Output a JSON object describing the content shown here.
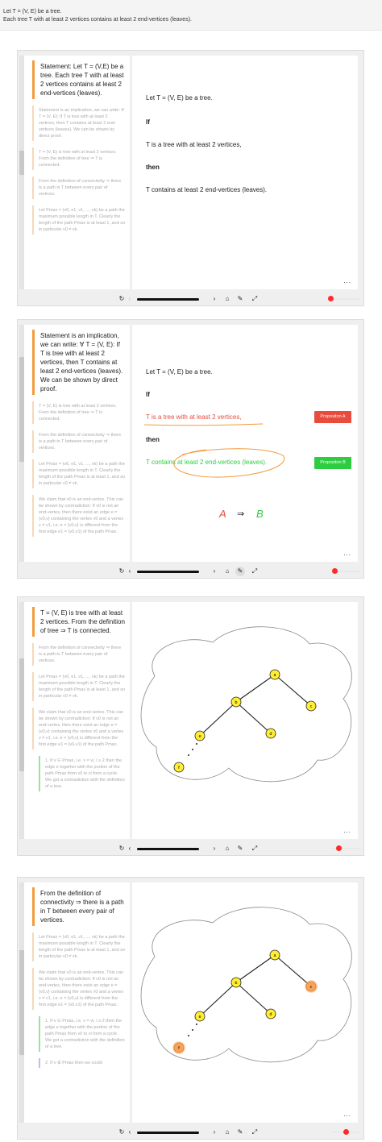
{
  "header": {
    "line1": "Let T = (V, E) be a tree.",
    "line2": "Each tree T with at least 2 vertices contains at least 2 end-vertices (leaves)."
  },
  "steps": {
    "statement": "Statement: Let T = (V,E) be a tree. Each tree T with at least 2 vertices contains at least 2 end-vertices (leaves).",
    "implication": "Statement is an implication, we can write: ∀ T = (V, E): If T is tree with at least 2 vertices, then T contains at least 2 end-vertices (leaves). We can be shown by direct proof.",
    "connected": "T = (V, E) is tree with at least 2 vertices. From the definition of tree ⇒ T is connected.",
    "path": "From the definition of connectivity ⇒ there is a path in T between every pair of vertices.",
    "maxpath": "Let Pmax = (v0, e1, v1, ..., vk) be a path the maximum possible length in T. Clearly the length of the path Pmax is at least 1, and so in particular v0 ≠ vk.",
    "claim": "We claim that v0 is an end-vertex. This can be shown by contradiction: If v0 is not an end-vertex, then there exist an edge e = {v0,v} containing the vertex v0 and a vertex v ≠ v1, i.e. e = {v0,v} is different from the first edge e1 = {v0,v1} of the path Pmax.",
    "case1": "1. If v ∈ Pmax, i.e. v = vi, i ≥ 2 then the edge e together with the portion of the path Pmax from v0 to vi form a cycle. We get a contradiction with the definition of a tree.",
    "case2": "2. If v ∉ Pmax then we could"
  },
  "content": {
    "let": "Let T = (V, E) be a tree.",
    "if": "If",
    "hyp": "T is a tree with at least 2 vertices,",
    "then": "then",
    "concl": "T contains at least 2 end-vertices (leaves).",
    "badge_a": "Propositon A",
    "badge_b": "Propositon B",
    "formula_a": "A",
    "formula_arrow": "⇒",
    "formula_b": "B",
    "more": "..."
  },
  "graph": {
    "nodes": [
      {
        "id": "a",
        "label": "a"
      },
      {
        "id": "b",
        "label": "b"
      },
      {
        "id": "c",
        "label": "c"
      },
      {
        "id": "d",
        "label": "d"
      },
      {
        "id": "e",
        "label": "e"
      },
      {
        "id": "f",
        "label": "f"
      }
    ]
  },
  "toolbar": {
    "reload": "↻",
    "prev": "‹",
    "next": "›",
    "home": "⌂",
    "bug": "✎",
    "expand": "⤢"
  },
  "colors": {
    "accent": "#f39c3d",
    "red": "#e74c3c",
    "green": "#2ecc40",
    "node": "#ffee33",
    "node_highlight": "#f7a35c"
  }
}
